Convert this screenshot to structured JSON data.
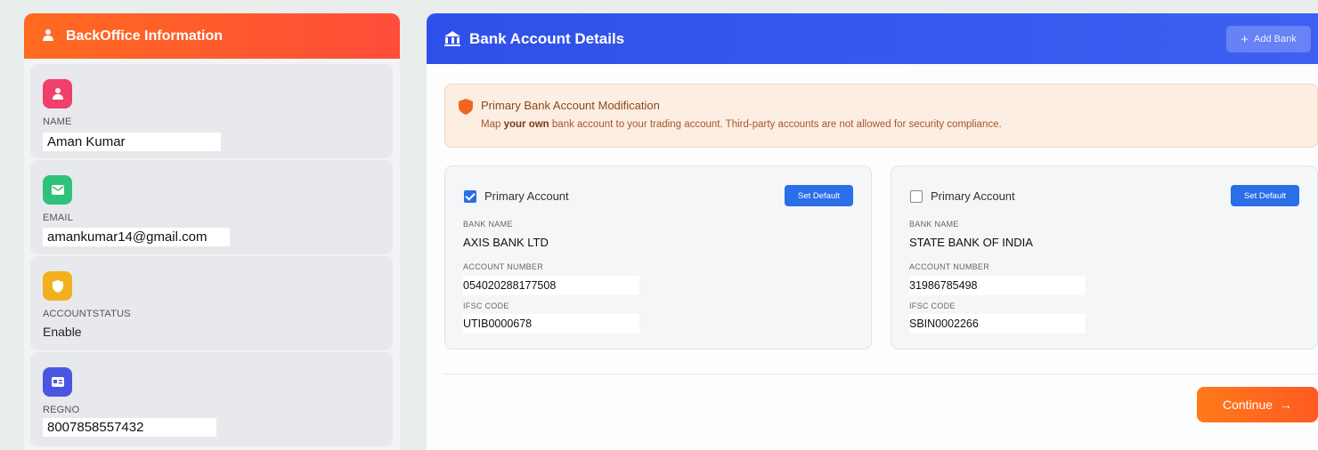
{
  "backoffice": {
    "title": "BackOffice Information",
    "fields": [
      {
        "label": "NAME",
        "value": "Aman Kumar",
        "icon": "person-icon",
        "color": "#ef3f6a"
      },
      {
        "label": "EMAIL",
        "value": "amankumar14@gmail.com",
        "icon": "mail-icon",
        "color": "#2ec27a"
      },
      {
        "label": "ACCOUNTSTATUS",
        "value": "Enable",
        "icon": "shield-icon",
        "color": "#f2b01e"
      },
      {
        "label": "REGNO",
        "value": "8007858557432",
        "icon": "id-card-icon",
        "color": "#4a56e2"
      }
    ]
  },
  "bank": {
    "title": "Bank Account Details",
    "add_label": "Add Bank",
    "alert": {
      "title": "Primary Bank Account Modification",
      "desc_prefix": "Map ",
      "desc_bold": "your own",
      "desc_suffix": " bank account to your trading account. Third-party accounts are not allowed for security compliance."
    },
    "accounts": [
      {
        "primary_label": "Primary Account",
        "checked": true,
        "set_default": "Set Default",
        "bank_name_label": "BANK NAME",
        "bank_name": "AXIS BANK LTD",
        "account_number_label": "ACCOUNT NUMBER",
        "account_number": "054020288177508",
        "ifsc_label": "IFSC CODE",
        "ifsc": "UTIB0000678"
      },
      {
        "primary_label": "Primary Account",
        "checked": false,
        "set_default": "Set Default",
        "bank_name_label": "BANK NAME",
        "bank_name": "STATE BANK OF INDIA",
        "account_number_label": "ACCOUNT NUMBER",
        "account_number": "31986785498",
        "ifsc_label": "IFSC CODE",
        "ifsc": "SBIN0002266"
      }
    ],
    "continue_label": "Continue"
  }
}
